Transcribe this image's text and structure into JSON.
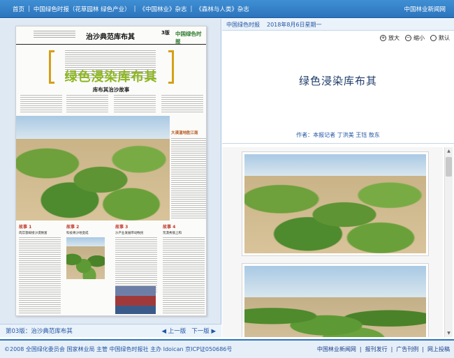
{
  "nav": {
    "items": [
      "首页",
      "中国绿色时报（花草园林 绿色产业）",
      "《中国林业》杂志",
      "《森林与人类》杂志"
    ],
    "brand": "中国林业新闻网"
  },
  "paper": {
    "section_title": "治沙典范库布其",
    "page_no": "3版",
    "logo": "中国绿色时报",
    "headline": "绿色浸染库布其",
    "subhead": "库布其治沙故事",
    "side_caption": "大漠湿地胜江南",
    "stories": [
      {
        "title": "故事 1",
        "head": "肉苁蓉嫁接沙漠致富"
      },
      {
        "title": "故事 2",
        "head": "科技将沙地变成"
      },
      {
        "title": "故事 3",
        "head": "沙产业发展带动牧民"
      },
      {
        "title": "故事 4",
        "head": "荒漠秀丽上和"
      }
    ]
  },
  "pagebar": {
    "label": "第03版：治沙典范库布其",
    "prev": "上一版",
    "next": "下一版"
  },
  "right": {
    "header_paper": "中国绿色时报",
    "header_date": "2018年8月6日星期一",
    "zoom_in": "放大",
    "zoom_out": "缩小",
    "zoom_default": "默认",
    "title": "绿色浸染库布其",
    "byline": "作者：本报记者 丁洪美 王钰 敖东"
  },
  "footer": {
    "copyright": "©2008 全国绿化委员会  国家林业局 主管  中国绿色时报社 主办 Idoican 京ICP证050686号",
    "links": [
      "中国林业新闻网",
      "报刊发行",
      "广告刊例",
      "网上投稿"
    ]
  }
}
